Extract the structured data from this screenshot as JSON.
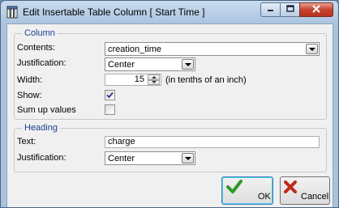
{
  "window": {
    "title": "Edit Insertable Table Column [ Start Time ]"
  },
  "column_group": {
    "title": "Column",
    "contents_label": "Contents:",
    "contents_value": "creation_time",
    "justification_label": "Justification:",
    "justification_value": "Center",
    "width_label": "Width:",
    "width_value": "15",
    "width_unit": "(in tenths of an inch)",
    "show_label": "Show:",
    "show_checked": true,
    "sum_label": "Sum up values",
    "sum_checked": false
  },
  "heading_group": {
    "title": "Heading",
    "text_label": "Text:",
    "text_value": "charge",
    "justification_label": "Justification:",
    "justification_value": "Center"
  },
  "buttons": {
    "ok_label": "OK",
    "cancel_label": "Cancel"
  },
  "colors": {
    "group_title": "#1b3d8f",
    "ok_icon": "#2e9a2e",
    "cancel_icon": "#c0281c"
  },
  "icons": {
    "app": "table-column-icon",
    "ok": "checkmark-icon",
    "cancel": "x-mark-icon"
  }
}
